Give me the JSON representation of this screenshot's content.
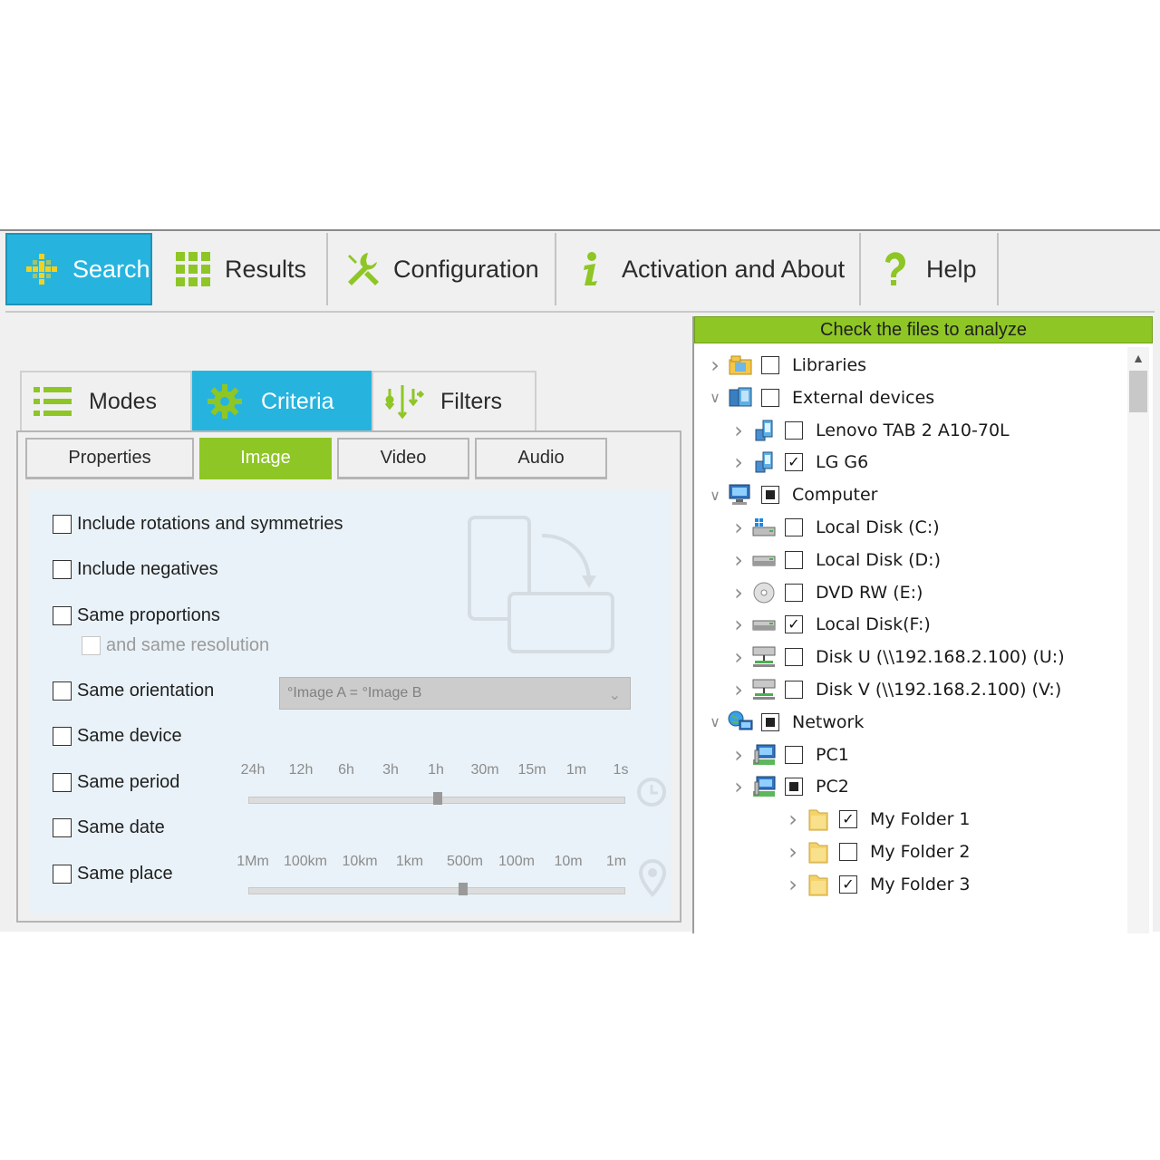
{
  "main_tabs": [
    {
      "label": "Search",
      "icon": "search-grid-icon",
      "active": true
    },
    {
      "label": "Results",
      "icon": "results-grid-icon",
      "active": false
    },
    {
      "label": "Configuration",
      "icon": "tools-icon",
      "active": false
    },
    {
      "label": "Activation and About",
      "icon": "info-icon",
      "active": false
    },
    {
      "label": "Help",
      "icon": "help-icon",
      "active": false
    }
  ],
  "sub_tabs": [
    {
      "label": "Modes",
      "icon": "list-icon",
      "active": false
    },
    {
      "label": "Criteria",
      "icon": "gear-icon",
      "active": true
    },
    {
      "label": "Filters",
      "icon": "filter-icon",
      "active": false
    }
  ],
  "media_tabs": [
    {
      "label": "Properties",
      "active": false
    },
    {
      "label": "Image",
      "active": true
    },
    {
      "label": "Video",
      "active": false
    },
    {
      "label": "Audio",
      "active": false
    }
  ],
  "options": {
    "rotations": "Include rotations and symmetries",
    "negatives": "Include negatives",
    "proportions": "Same proportions",
    "resolution": "and same resolution",
    "orientation": "Same orientation",
    "device": "Same device",
    "period": "Same period",
    "date": "Same date",
    "place": "Same place"
  },
  "orientation_select": {
    "value": "°Image A  =  °Image B"
  },
  "period_scale": {
    "labels": [
      "24h",
      "12h",
      "6h",
      "3h",
      "1h",
      "30m",
      "15m",
      "1m",
      "1s"
    ],
    "value_index": 4
  },
  "place_scale": {
    "labels": [
      "1Mm",
      "100km",
      "10km",
      "1km",
      "500m",
      "100m",
      "10m",
      "1m"
    ],
    "value_index": 4
  },
  "tree": {
    "header": "Check the files to analyze",
    "nodes": [
      {
        "label": "Libraries",
        "check": "unchecked",
        "expanded": false,
        "icon": "libraries-icon"
      },
      {
        "label": "External devices",
        "check": "unchecked",
        "expanded": true,
        "icon": "external-devices-icon"
      },
      {
        "label": "Lenovo TAB 2 A10-70L",
        "check": "unchecked",
        "expanded": false,
        "icon": "phone-icon"
      },
      {
        "label": "LG G6",
        "check": "checked",
        "expanded": false,
        "icon": "phone-icon"
      },
      {
        "label": "Computer",
        "check": "partial",
        "expanded": true,
        "icon": "computer-icon"
      },
      {
        "label": "Local Disk (C:)",
        "check": "unchecked",
        "expanded": false,
        "icon": "system-disk-icon"
      },
      {
        "label": "Local Disk (D:)",
        "check": "unchecked",
        "expanded": false,
        "icon": "disk-icon"
      },
      {
        "label": "DVD RW (E:)",
        "check": "unchecked",
        "expanded": false,
        "icon": "dvd-icon"
      },
      {
        "label": "Local Disk(F:)",
        "check": "checked",
        "expanded": false,
        "icon": "disk-icon"
      },
      {
        "label": "Disk U  (\\\\192.168.2.100) (U:)",
        "check": "unchecked",
        "expanded": false,
        "icon": "network-drive-icon"
      },
      {
        "label": "Disk V  (\\\\192.168.2.100) (V:)",
        "check": "unchecked",
        "expanded": false,
        "icon": "network-drive-icon"
      },
      {
        "label": "Network",
        "check": "partial",
        "expanded": true,
        "icon": "network-icon"
      },
      {
        "label": "PC1",
        "check": "unchecked",
        "expanded": false,
        "icon": "pc-icon"
      },
      {
        "label": "PC2",
        "check": "partial",
        "expanded": false,
        "icon": "pc-icon"
      },
      {
        "label": "My Folder 1",
        "check": "checked",
        "expanded": false,
        "icon": "folder-icon"
      },
      {
        "label": "My Folder 2",
        "check": "unchecked",
        "expanded": false,
        "icon": "folder-icon"
      },
      {
        "label": "My Folder 3",
        "check": "checked",
        "expanded": false,
        "icon": "folder-icon"
      }
    ]
  },
  "colors": {
    "accent_blue": "#26b4df",
    "accent_green": "#8ec625",
    "panel_bg": "#e9f2f8"
  }
}
